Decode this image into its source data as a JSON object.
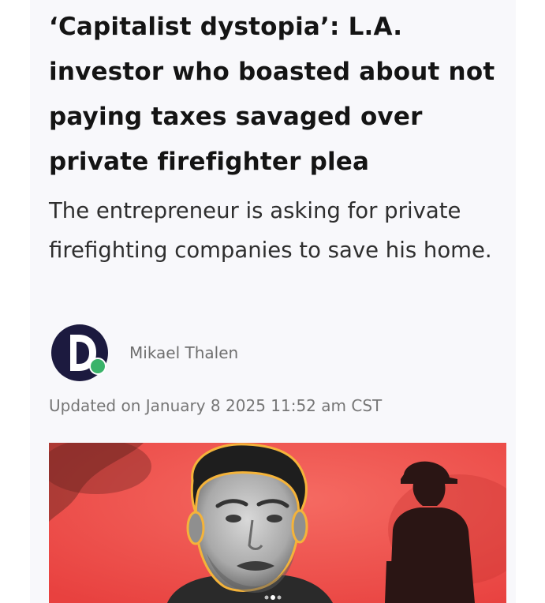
{
  "article": {
    "headline": "‘Capitalist dystopia’: L.A. investor who boasted about not paying taxes savaged over private firefighter plea",
    "dek": "The entrepreneur is asking for private firefighting companies to save his home.",
    "author": {
      "name": "Mikael Thalen",
      "avatar_icon": "daily-dot-logo-icon"
    },
    "updated": "Updated on January 8 2025 11:52 am CST"
  },
  "colors": {
    "background": "#f8f8fb",
    "headline": "#141414",
    "hero_red": "#f04e4a",
    "logo_navy": "#1c1a3f",
    "logo_dot": "#3ab36a"
  }
}
